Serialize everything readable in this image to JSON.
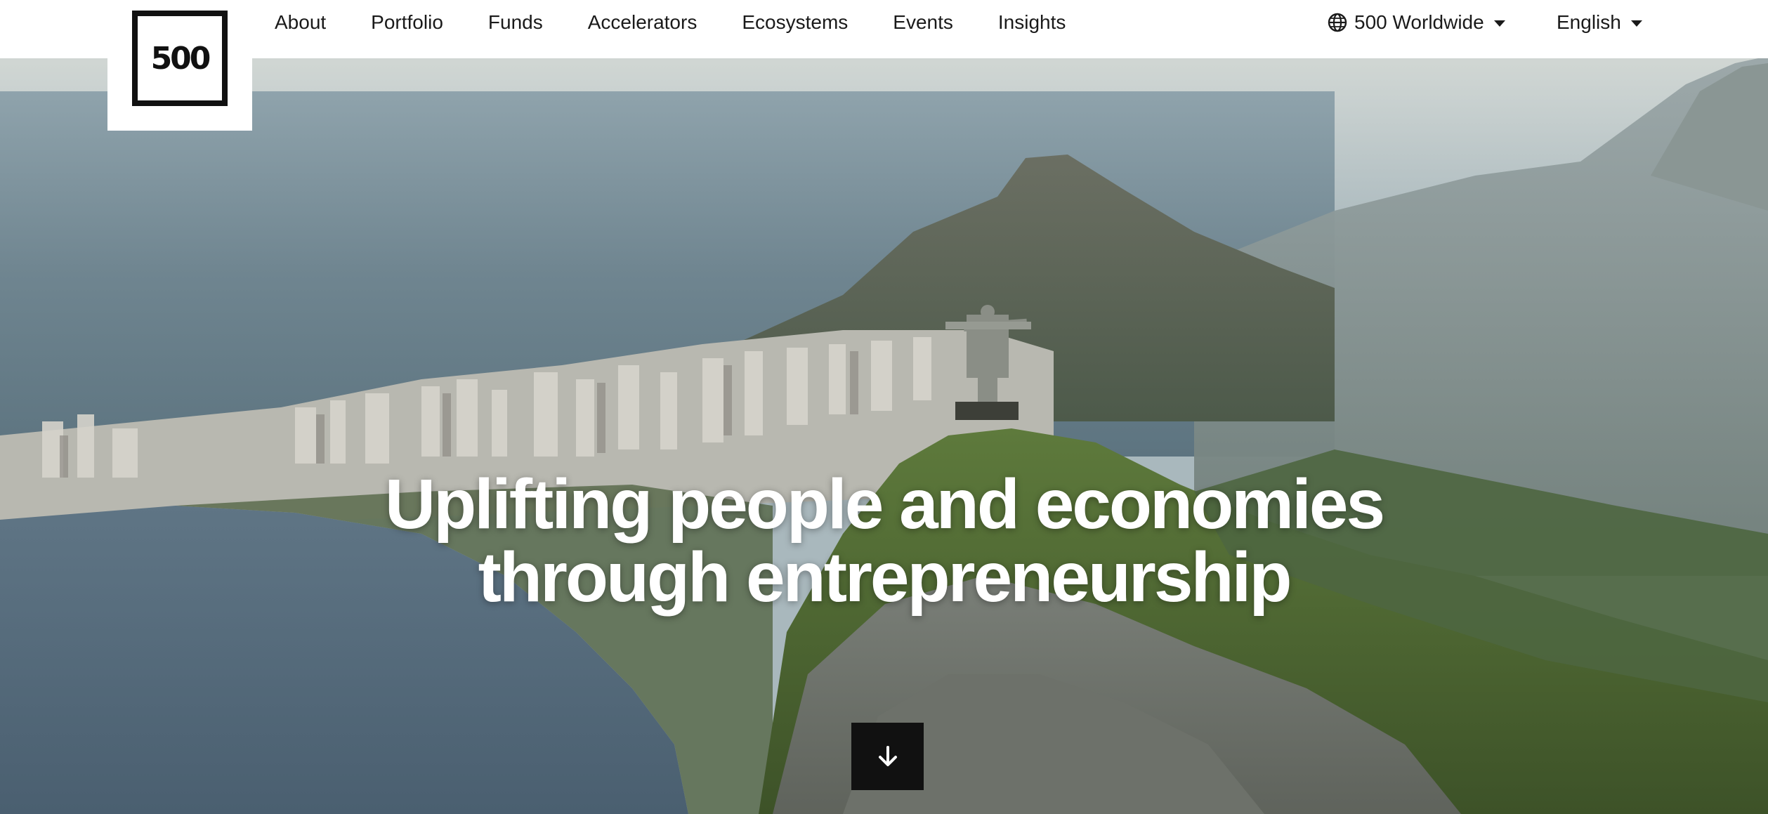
{
  "brand": {
    "logo_text": "500"
  },
  "nav": {
    "items": [
      {
        "label": "About"
      },
      {
        "label": "Portfolio"
      },
      {
        "label": "Funds"
      },
      {
        "label": "Accelerators"
      },
      {
        "label": "Ecosystems"
      },
      {
        "label": "Events"
      },
      {
        "label": "Insights"
      }
    ],
    "region": {
      "label": "500 Worldwide",
      "icon": "globe-icon"
    },
    "language": {
      "label": "English"
    }
  },
  "hero": {
    "line1": "Uplifting people and economies",
    "line2": "through entrepreneurship",
    "scroll_icon": "arrow-down-icon"
  },
  "colors": {
    "nav_bg": "#ffffff",
    "text_dark": "#1a1a1a",
    "headline": "#ffffff",
    "scroll_button_bg": "#111111"
  }
}
